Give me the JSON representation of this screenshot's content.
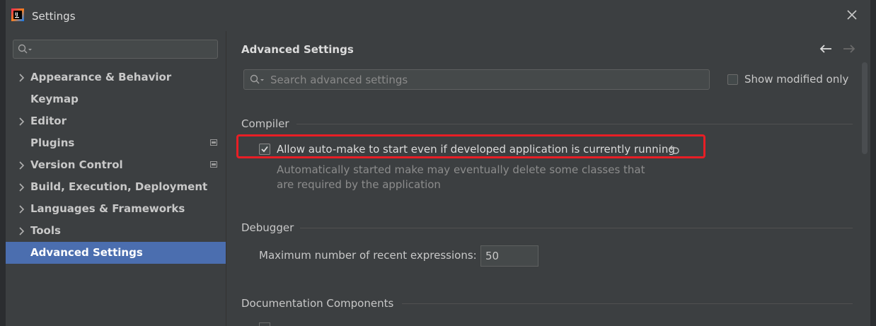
{
  "window": {
    "title": "Settings"
  },
  "sidebar": {
    "items": [
      {
        "label": "Appearance & Behavior",
        "expandable": true,
        "badge": false,
        "selected": false
      },
      {
        "label": "Keymap",
        "expandable": false,
        "badge": false,
        "selected": false
      },
      {
        "label": "Editor",
        "expandable": true,
        "badge": false,
        "selected": false
      },
      {
        "label": "Plugins",
        "expandable": false,
        "badge": true,
        "selected": false
      },
      {
        "label": "Version Control",
        "expandable": true,
        "badge": true,
        "selected": false
      },
      {
        "label": "Build, Execution, Deployment",
        "expandable": true,
        "badge": false,
        "selected": false
      },
      {
        "label": "Languages & Frameworks",
        "expandable": true,
        "badge": false,
        "selected": false
      },
      {
        "label": "Tools",
        "expandable": true,
        "badge": false,
        "selected": false
      },
      {
        "label": "Advanced Settings",
        "expandable": false,
        "badge": false,
        "selected": true
      }
    ]
  },
  "main": {
    "title": "Advanced Settings",
    "search_placeholder": "Search advanced settings",
    "show_modified_label": "Show modified only",
    "show_modified_checked": false,
    "sections": {
      "compiler": {
        "title": "Compiler",
        "option_label": "Allow auto-make to start even if developed application is currently running",
        "option_checked": true,
        "description_line1": "Automatically started make may eventually delete some classes that",
        "description_line2": "are required by the application"
      },
      "debugger": {
        "title": "Debugger",
        "field_label": "Maximum number of recent expressions:",
        "field_value": "50"
      },
      "documentation": {
        "title": "Documentation Components"
      }
    }
  },
  "colors": {
    "accent": "#4b6eaf",
    "highlight": "#e81e25",
    "background": "#3c3f41"
  }
}
